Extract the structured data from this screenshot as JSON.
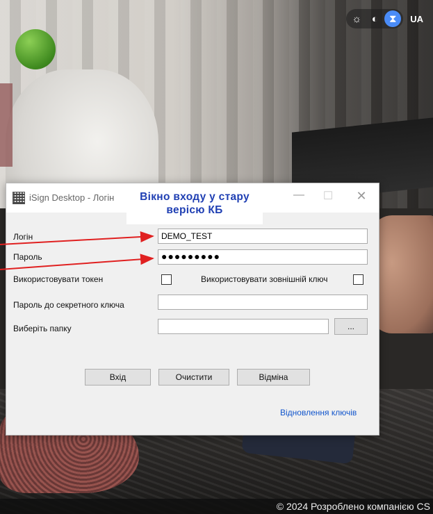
{
  "toolbar": {
    "icons": [
      "sun-icon",
      "moon-icon",
      "hourglass-icon"
    ],
    "active_icon": "hourglass-icon",
    "language": "UA",
    "accent_color": "#4a8cf7"
  },
  "window": {
    "title": "iSign Desktop - Логін",
    "controls": {
      "minimize": "—",
      "maximize": "☐",
      "close": "✕"
    }
  },
  "callout": {
    "text": "Вікно входу у стару\nверісю КБ",
    "color": "#1f3fb3"
  },
  "form": {
    "login_label": "Логін",
    "login_value": "DEMO_TEST",
    "password_label": "Пароль",
    "password_value": "●●●●●●●●●",
    "use_token_label": "Використовувати токен",
    "use_token_checked": false,
    "use_external_key_label": "Використовувати зовнішній ключ",
    "use_external_key_checked": false,
    "secret_key_password_label": "Пароль до секретного ключа",
    "secret_key_password_value": "",
    "folder_label": "Виберіть папку",
    "folder_value": "",
    "browse_label": "...",
    "login_button": "Вхід",
    "clear_button": "Очистити",
    "cancel_button": "Відміна",
    "restore_keys_link": "Відновлення ключів"
  },
  "footer": {
    "text": "© 2024 Розроблено компанією CS"
  },
  "annotation_color": "#e02020"
}
